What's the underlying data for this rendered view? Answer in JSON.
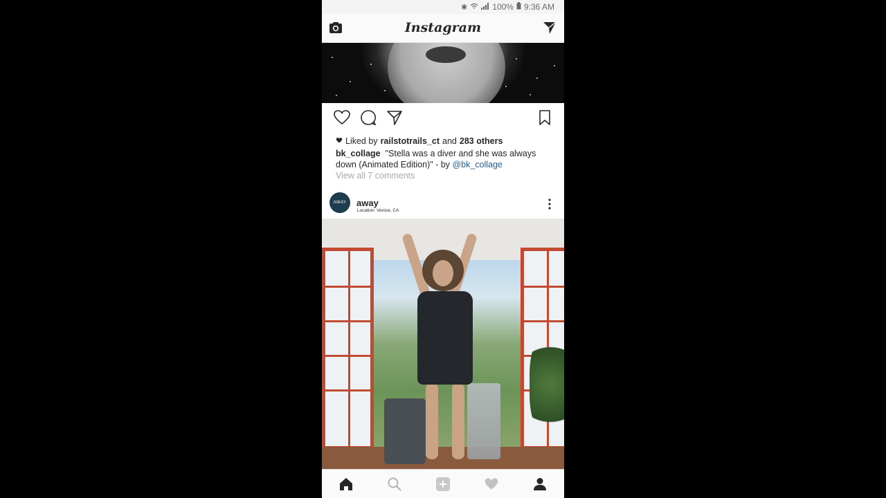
{
  "status_bar": {
    "battery": "100%",
    "time": "9:36 AM"
  },
  "header": {
    "app_title": "Instagram"
  },
  "post1": {
    "likes": {
      "prefix": "Liked by",
      "user": "railstotrails_ct",
      "joiner": "and",
      "others": "283 others"
    },
    "caption": {
      "user": "bk_collage",
      "text": "\"Stella was a diver and she was always down (Animated Edition)\" - by",
      "mention": "@bk_collage"
    },
    "view_comments": "View all 7 comments"
  },
  "post2": {
    "avatar_text": "AWAY",
    "username": "away",
    "location": "Location: Venice, CA"
  },
  "icons": {
    "camera": "camera-icon",
    "direct": "direct-message-icon",
    "like": "heart-icon",
    "comment": "comment-icon",
    "share": "share-icon",
    "save": "bookmark-icon",
    "more": "more-options-icon",
    "home": "home-icon",
    "search": "search-icon",
    "add": "add-post-icon",
    "activity": "activity-heart-icon",
    "profile": "profile-icon"
  },
  "colors": {
    "accent_link": "#1f5c99",
    "muted_text": "#a8a8a8",
    "avatar_bg": "#1d3c4e"
  }
}
